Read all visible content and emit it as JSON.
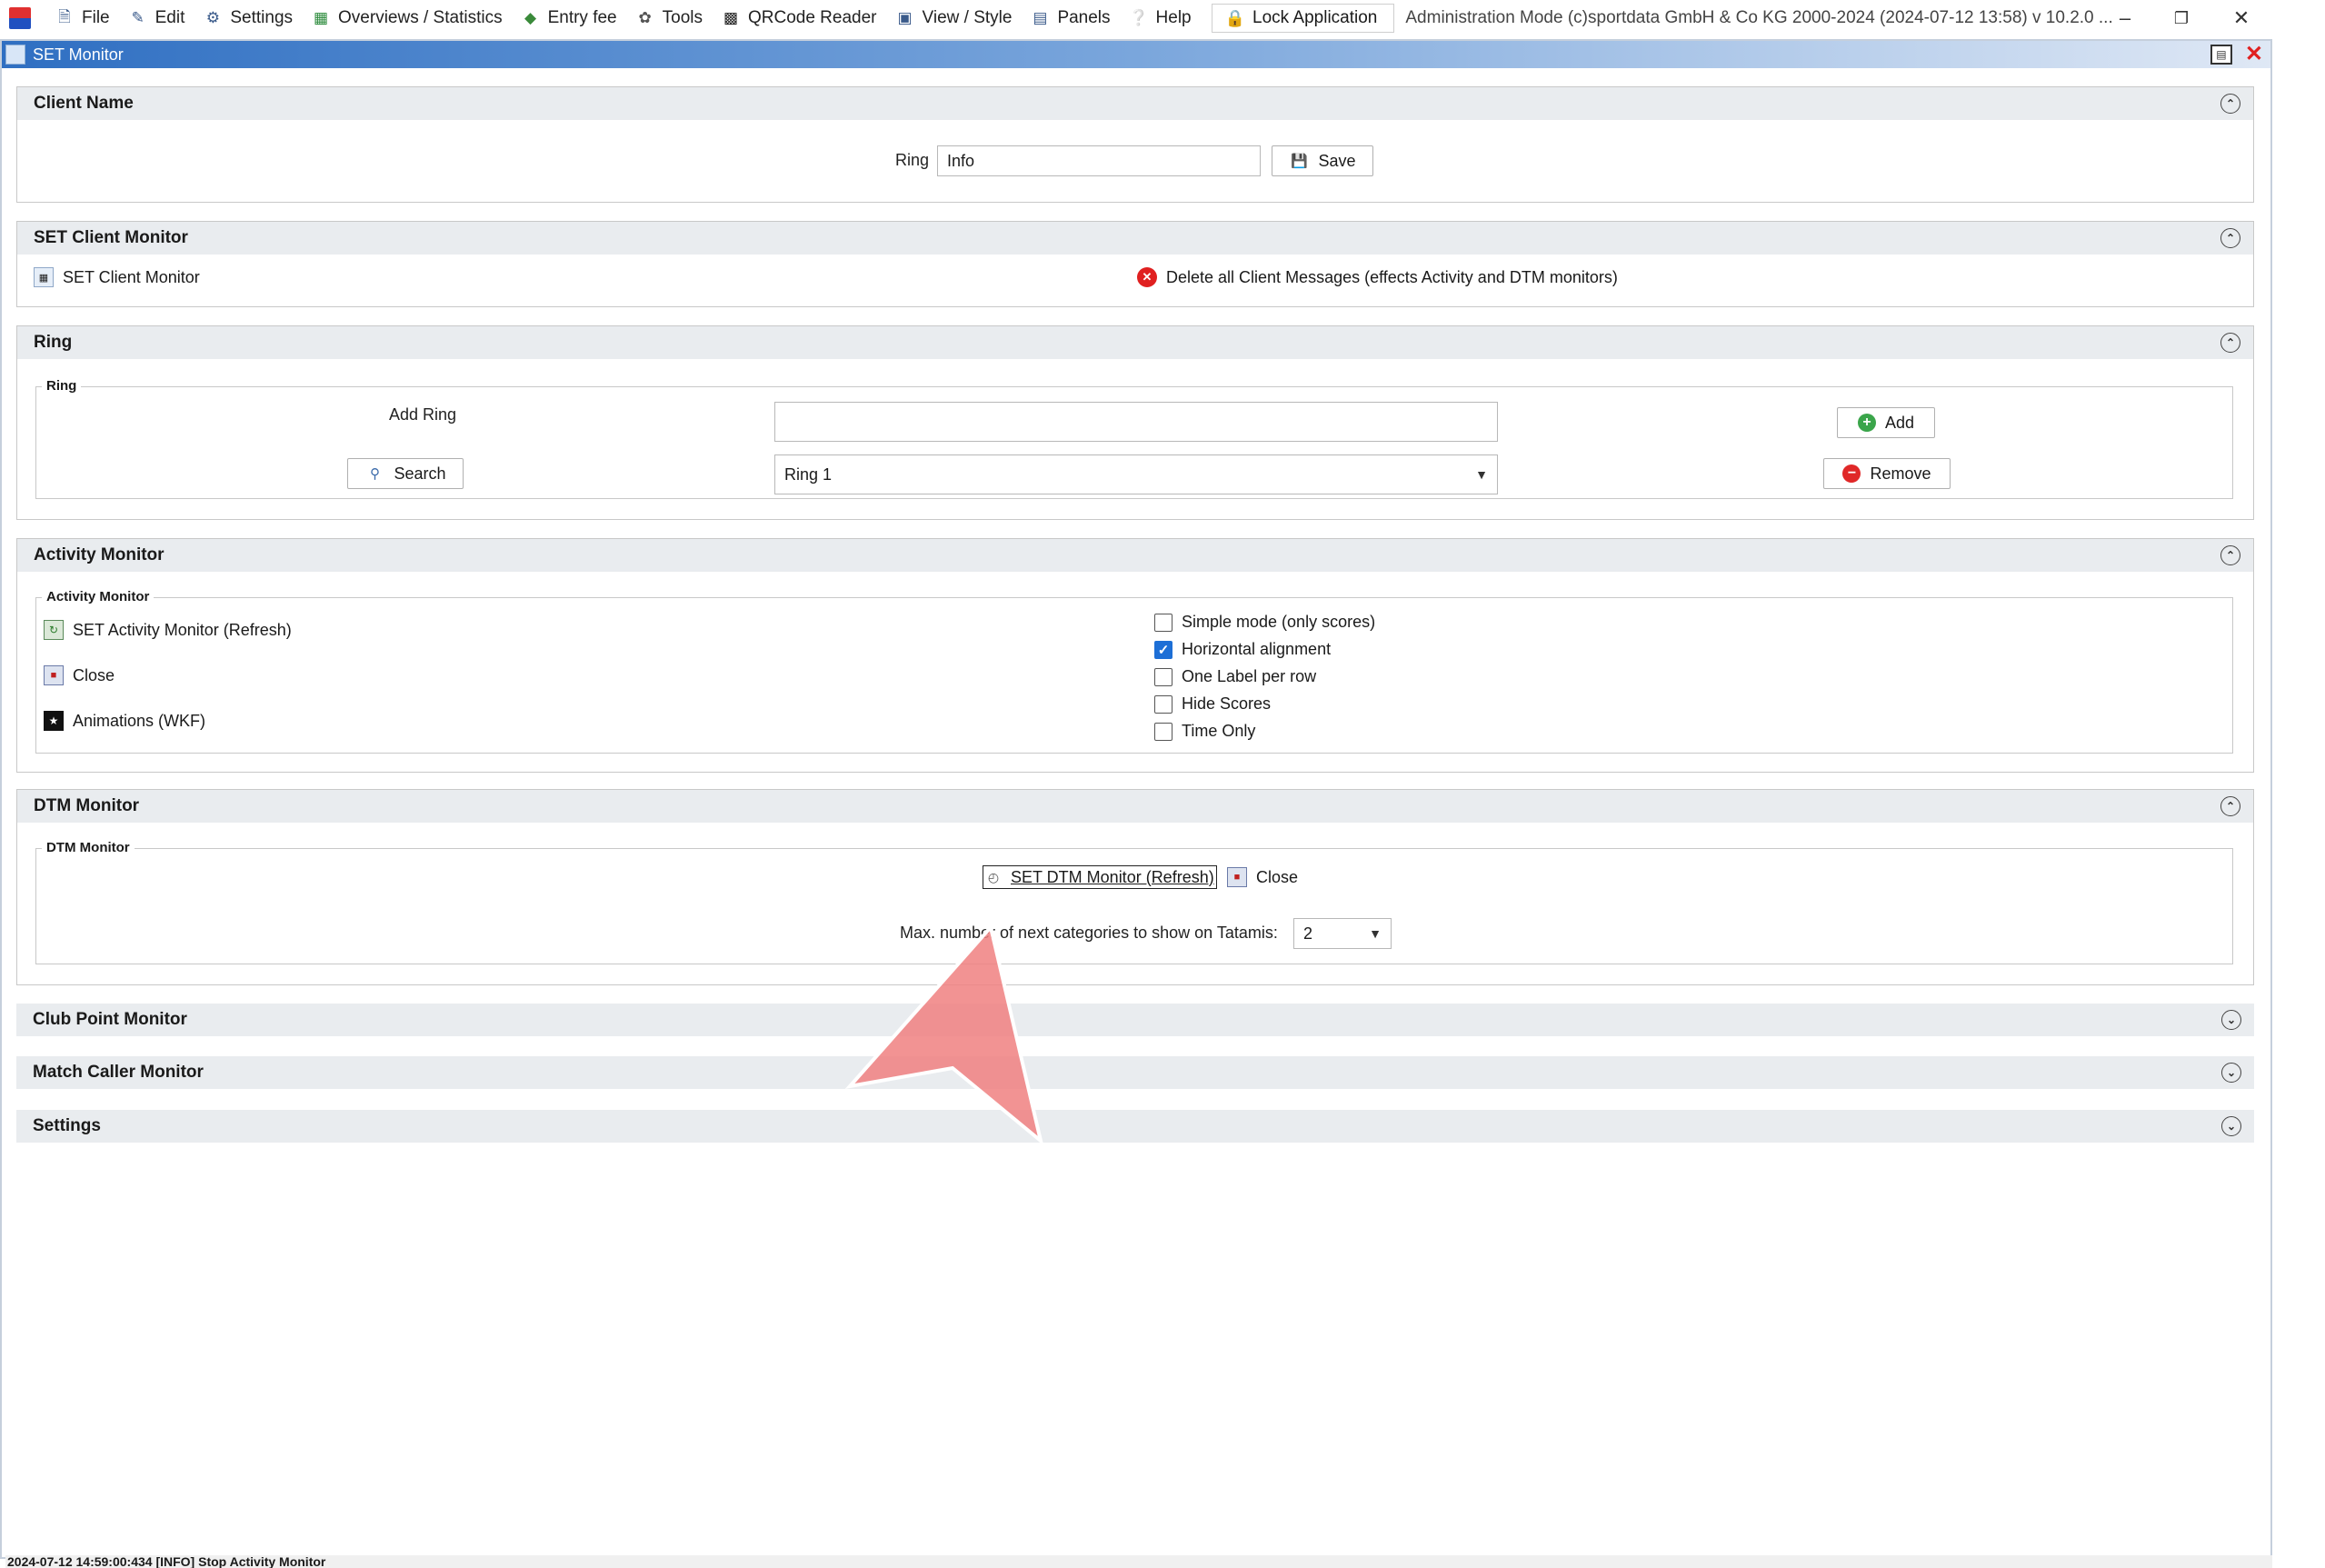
{
  "menubar": {
    "items": [
      {
        "label": "File",
        "icon": "file-icon"
      },
      {
        "label": "Edit",
        "icon": "edit-icon"
      },
      {
        "label": "Settings",
        "icon": "gear-icon"
      },
      {
        "label": "Overviews / Statistics",
        "icon": "statistics-icon"
      },
      {
        "label": "Entry fee",
        "icon": "money-icon"
      },
      {
        "label": "Tools",
        "icon": "wrench-icon"
      },
      {
        "label": "QRCode Reader",
        "icon": "qrcode-icon"
      },
      {
        "label": "View / Style",
        "icon": "view-icon"
      },
      {
        "label": "Panels",
        "icon": "panels-icon"
      },
      {
        "label": "Help",
        "icon": "help-icon"
      }
    ],
    "lock_label": "Lock Application",
    "admin_text": "Administration Mode (c)sportdata GmbH & Co KG 2000-2024 (2024-07-12 13:58)  v 10.2.0 ..."
  },
  "window": {
    "title": "SET Monitor"
  },
  "client_name": {
    "header": "Client Name",
    "ring_label": "Ring",
    "ring_value": "Info",
    "save_label": "Save"
  },
  "set_client_monitor": {
    "header": "SET Client Monitor",
    "link_label": "SET Client Monitor",
    "delete_label": "Delete all Client Messages (effects Activity and DTM monitors)"
  },
  "ring": {
    "header": "Ring",
    "legend": "Ring",
    "add_ring_label": "Add Ring",
    "add_ring_value": "",
    "search_label": "Search",
    "selected_ring": "Ring 1",
    "add_label": "Add",
    "remove_label": "Remove"
  },
  "activity_monitor": {
    "header": "Activity Monitor",
    "legend": "Activity Monitor",
    "refresh_label": "SET Activity Monitor (Refresh)",
    "close_label": "Close",
    "animations_label": "Animations (WKF)",
    "options": [
      {
        "label": "Simple mode (only scores)",
        "checked": false
      },
      {
        "label": "Horizontal alignment",
        "checked": true
      },
      {
        "label": "One Label per row",
        "checked": false
      },
      {
        "label": "Hide Scores",
        "checked": false
      },
      {
        "label": "Time Only",
        "checked": false
      }
    ]
  },
  "dtm_monitor": {
    "header": "DTM Monitor",
    "legend": "DTM Monitor",
    "refresh_label": "SET DTM Monitor (Refresh)",
    "close_label": "Close",
    "max_label": "Max. number of next categories to show on Tatamis:",
    "max_value": "2"
  },
  "collapsed_sections": {
    "club_point": "Club Point Monitor",
    "match_caller": "Match Caller Monitor",
    "settings": "Settings"
  },
  "status": {
    "text": "2024-07-12 14:59:00:434 [INFO] Stop Activity Monitor"
  },
  "colors": {
    "accent": "#1d6fd6",
    "header_bg": "#e9ecef",
    "delete_red": "#e02020",
    "arrow": "#f08080"
  }
}
